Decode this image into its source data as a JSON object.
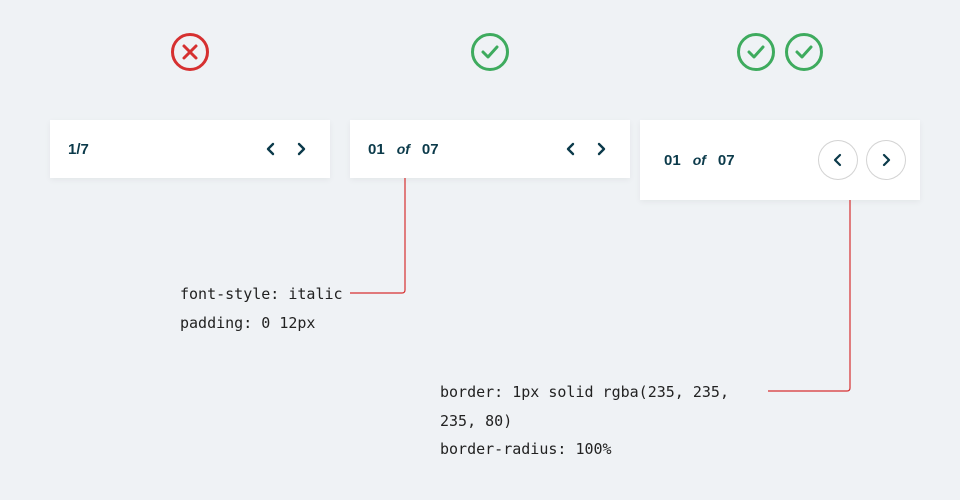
{
  "variants": {
    "v1": {
      "label": "1/7"
    },
    "v2": {
      "current": "01",
      "sep": "of",
      "total": "07"
    },
    "v3": {
      "current": "01",
      "sep": "of",
      "total": "07"
    }
  },
  "annotations": {
    "a1_line1": "font-style: italic",
    "a1_line2": "padding: 0 12px",
    "a2_line1": "border: 1px solid rgba(235, 235, 235, 80)",
    "a2_line2": "border-radius: 100%"
  }
}
